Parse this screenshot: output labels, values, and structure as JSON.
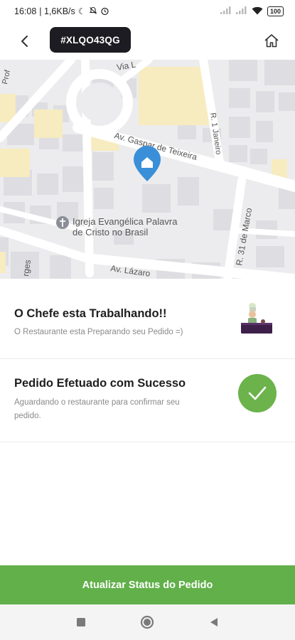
{
  "status_bar": {
    "time": "16:08",
    "network_speed": "| 1,6KB/s",
    "battery": "100"
  },
  "header": {
    "order_code": "#XLQO43QG",
    "back_icon": "arrow-left-icon",
    "home_icon": "home-icon"
  },
  "map": {
    "streets": {
      "via": "Via L",
      "av_gaspar": "Av. Gaspar de Teixeira",
      "r_31_marco": "R. 31 de Marco",
      "av_lazaro": "Av. Lázaro",
      "jardim": "rges",
      "r_1_janeiro": "R. 1 Janeiro",
      "prof": "Prof"
    },
    "poi_church": {
      "line1": "Igreja Evangélica Palavra",
      "line2": "de Cristo no Brasil"
    }
  },
  "steps": [
    {
      "title": "O Chefe esta Trabalhando!!",
      "subtitle": "O Restaurante esta Preparando seu Pedido =)",
      "icon": "chef-cooking-icon"
    },
    {
      "title": "Pedido Efetuado com Sucesso",
      "subtitle_line1": "Aguardando o restaurante para confirmar seu",
      "subtitle_line2": "pedido.",
      "icon": "checkmark-icon"
    }
  ],
  "action": {
    "update_label": "Atualizar Status do Pedido"
  },
  "colors": {
    "accent_green": "#61b04a",
    "chip_dark": "#1c1c22",
    "map_pin_blue": "#3a8fd8"
  }
}
